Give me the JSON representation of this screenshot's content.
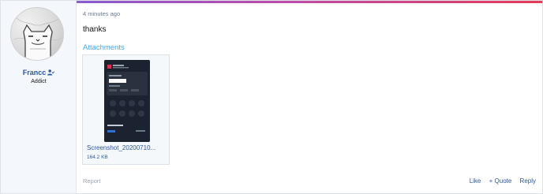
{
  "post": {
    "user": {
      "name": "Francc",
      "title": "Addict"
    },
    "timestamp": "4 minutes ago",
    "message": "thanks",
    "attachments_heading": "Attachments",
    "attachment": {
      "filename": "Screenshot_20200710...",
      "size": "164.2 KB"
    },
    "report_label": "Report",
    "actions": {
      "like": "Like",
      "quote": "+ Quote",
      "reply": "Reply"
    }
  },
  "colors": {
    "link": "#2c5a9c",
    "accent": "#47a7eb"
  }
}
